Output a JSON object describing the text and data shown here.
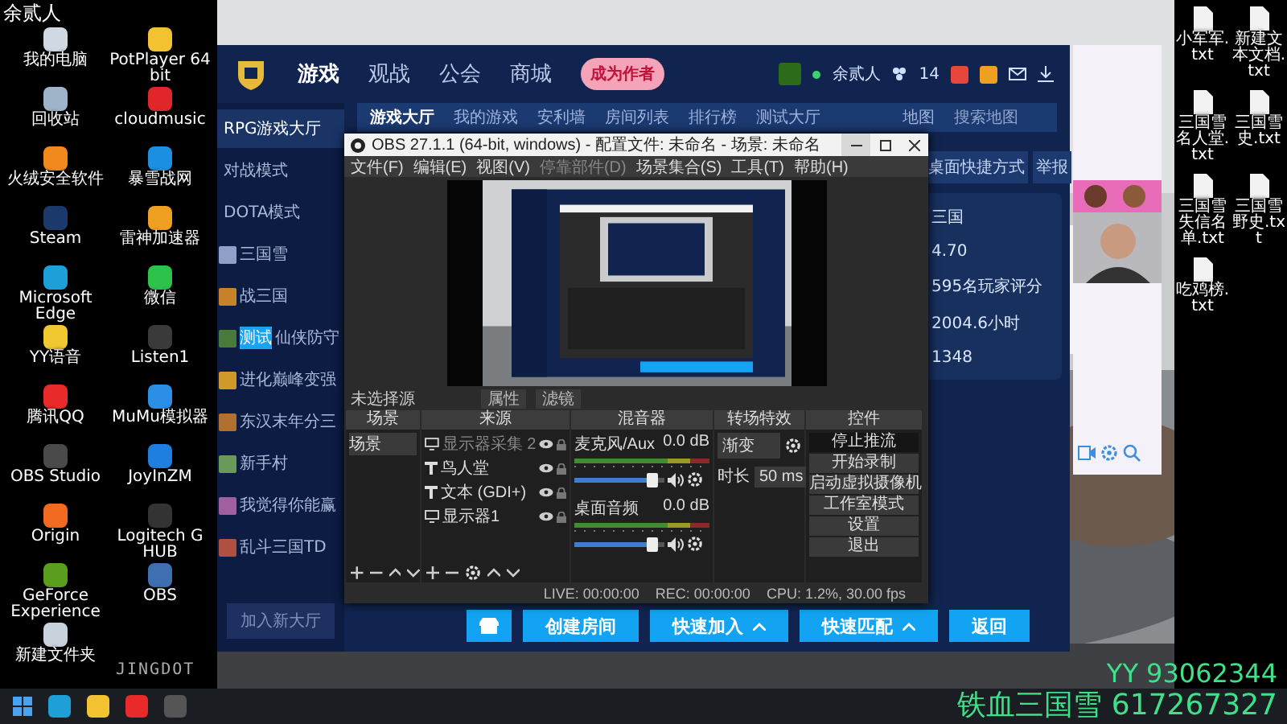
{
  "overlay": {
    "streamer": "余贰人",
    "watermark": "JINGDOT",
    "lines": [
      "YY 93062344",
      "铁血三国雪 617267327"
    ]
  },
  "desktop_left": {
    "icons": [
      {
        "label": "我的电脑",
        "color": "#cfd8e3"
      },
      {
        "label": "PotPlayer 64 bit",
        "color": "#f2c230"
      },
      {
        "label": "回收站",
        "color": "#9fb4c8"
      },
      {
        "label": "cloudmusic",
        "color": "#e0262b"
      },
      {
        "label": "火绒安全软件",
        "color": "#f08a1c"
      },
      {
        "label": "暴雪战网",
        "color": "#1c8fe0"
      },
      {
        "label": "Steam",
        "color": "#1b3a6b"
      },
      {
        "label": "雷神加速器",
        "color": "#f0a020"
      },
      {
        "label": "Microsoft Edge",
        "color": "#1f9fd8"
      },
      {
        "label": "微信",
        "color": "#2dc24a"
      },
      {
        "label": "YY语音",
        "color": "#f2c830"
      },
      {
        "label": "Listen1",
        "color": "#3a3a3a"
      },
      {
        "label": "腾讯QQ",
        "color": "#e82a2a"
      },
      {
        "label": "MuMu模拟器",
        "color": "#2b8fe6"
      },
      {
        "label": "OBS Studio",
        "color": "#4a4a4a"
      },
      {
        "label": "JoyInZM",
        "color": "#1f7fe0"
      },
      {
        "label": "Origin",
        "color": "#f26b21"
      },
      {
        "label": "Logitech G HUB",
        "color": "#333333"
      },
      {
        "label": "GeForce Experience",
        "color": "#5a9e1e"
      },
      {
        "label": "OBS",
        "color": "#3f6fb0"
      },
      {
        "label": "新建文件夹",
        "color": "#c8d2dc"
      }
    ]
  },
  "game_client": {
    "nav": [
      {
        "label": "游戏",
        "selected": true
      },
      {
        "label": "观战",
        "selected": false
      },
      {
        "label": "公会",
        "selected": false
      },
      {
        "label": "商城",
        "selected": false
      }
    ],
    "promo_badge": "成为作者",
    "user": "余贰人",
    "notification_count": "14",
    "subtabs": [
      {
        "label": "游戏大厅",
        "selected": true
      },
      {
        "label": "我的游戏",
        "selected": false
      },
      {
        "label": "安利墙",
        "selected": false
      },
      {
        "label": "房间列表",
        "selected": false
      },
      {
        "label": "排行榜",
        "selected": false
      },
      {
        "label": "测试大厅",
        "selected": false
      }
    ],
    "map_filter": "地图",
    "search": {
      "placeholder": "搜索地图"
    },
    "modes": [
      {
        "label": "RPG游戏大厅",
        "selected": true
      },
      {
        "label": "对战模式",
        "selected": false
      },
      {
        "label": "DOTA模式",
        "selected": false
      }
    ],
    "games": [
      {
        "label": "三国雪",
        "color": "#8fa0c8"
      },
      {
        "label": "战三国",
        "color": "#c8822a"
      },
      {
        "label": "仙侠防守",
        "tag": "测试",
        "color": "#4a7a3a"
      },
      {
        "label": "进化巅峰变强",
        "color": "#d09a2a"
      },
      {
        "label": "东汉末年分三",
        "color": "#b07030"
      },
      {
        "label": "新手村",
        "color": "#6a9a5a"
      },
      {
        "label": "我觉得你能赢",
        "color": "#a060a0"
      },
      {
        "label": "乱斗三国TD",
        "color": "#b05040"
      }
    ],
    "join_button": "加入新大厅",
    "detail_buttons": [
      "桌面快捷方式",
      "举报"
    ],
    "detail_lines": [
      "三国",
      "4.70",
      "595名玩家评分",
      "2004.6小时",
      "1348"
    ],
    "actions": [
      {
        "label": "创建房间",
        "dropdown": false
      },
      {
        "label": "快速加入",
        "dropdown": true
      },
      {
        "label": "快速匹配",
        "dropdown": true
      },
      {
        "label": "返回",
        "dropdown": false
      }
    ]
  },
  "obs": {
    "title": "OBS 27.1.1 (64-bit, windows) - 配置文件: 未命名 - 场景: 未命名",
    "menu": [
      "文件(F)",
      "编辑(E)",
      "视图(V)",
      "停靠部件(D)",
      "场景集合(S)",
      "工具(T)",
      "帮助(H)"
    ],
    "no_source": "未选择源",
    "source_buttons": [
      "属性",
      "滤镜"
    ],
    "docks": {
      "scenes": "场景",
      "sources": "来源",
      "mixer": "混音器",
      "transitions": "转场特效",
      "controls": "控件"
    },
    "scenes": [
      "场景"
    ],
    "sources": [
      {
        "label": "显示器采集 2",
        "kind": "display",
        "visible": false
      },
      {
        "label": "鸟人堂",
        "kind": "text",
        "visible": true
      },
      {
        "label": "文本 (GDI+)",
        "kind": "text",
        "visible": true
      },
      {
        "label": "显示器1",
        "kind": "display",
        "visible": true
      }
    ],
    "mixer": [
      {
        "name": "麦克风/Aux",
        "reading": "0.0 dB",
        "level": 0.88
      },
      {
        "name": "桌面音频",
        "reading": "0.0 dB",
        "level": 0.88
      }
    ],
    "transition": {
      "type": "渐变",
      "duration_label": "时长",
      "duration": "50 ms"
    },
    "controls": [
      {
        "label": "停止推流",
        "active": true
      },
      {
        "label": "开始录制",
        "active": false
      },
      {
        "label": "启动虚拟摄像机",
        "active": false
      },
      {
        "label": "工作室模式",
        "active": false
      },
      {
        "label": "设置",
        "active": false
      },
      {
        "label": "退出",
        "active": false
      }
    ],
    "status": [
      "LIVE: 00:00:00",
      "REC: 00:00:00",
      "CPU: 1.2%, 30.00 fps"
    ]
  },
  "desktop_right": {
    "icons": [
      {
        "label": "小军军.txt"
      },
      {
        "label": "新建文本文档.txt"
      },
      {
        "label": "三国雪名人堂.txt"
      },
      {
        "label": "三国雪史.txt"
      },
      {
        "label": "三国雪失信名单.txt"
      },
      {
        "label": "三国雪野史.txt"
      },
      {
        "label": "吃鸡榜.txt"
      }
    ]
  }
}
